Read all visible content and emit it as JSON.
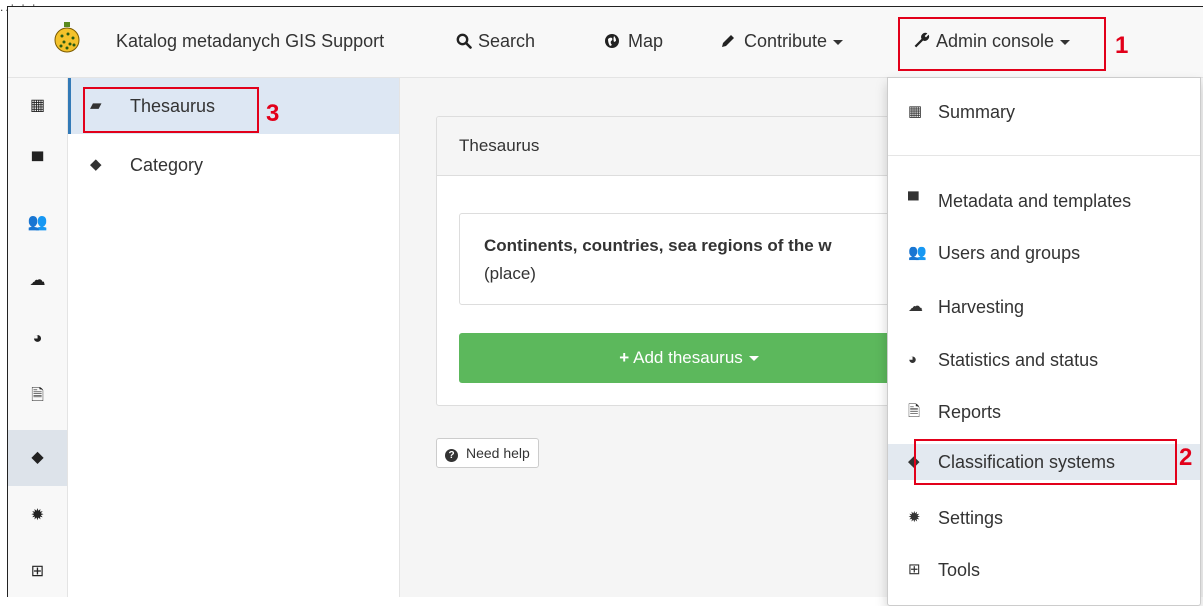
{
  "top_corner_mark": "..;.;.;",
  "navbar": {
    "brand": "Katalog metadanych GIS Support",
    "items": [
      {
        "label": "Search",
        "icon": "search-icon"
      },
      {
        "label": "Map",
        "icon": "globe-icon"
      },
      {
        "label": "Contribute",
        "icon": "pencil-icon"
      },
      {
        "label": "Admin console",
        "icon": "wrench-icon"
      }
    ]
  },
  "annotations": {
    "one": "1",
    "two": "2",
    "three": "3"
  },
  "icon_sidebar": [
    "grid-icon",
    "archive-icon",
    "users-icon",
    "cloud-download-icon",
    "dashboard-icon",
    "file-icon",
    "tags-icon",
    "gear-icon",
    "medkit-icon"
  ],
  "subsidebar": [
    {
      "label": "Thesaurus",
      "icon": "book-icon"
    },
    {
      "label": "Category",
      "icon": "tags-icon"
    }
  ],
  "main": {
    "panel_title": "Thesaurus",
    "thesaurus_title": "Continents, countries, sea regions of the w",
    "thesaurus_type": "(place)",
    "add_button": "Add thesaurus",
    "help_button": "Need help"
  },
  "dropdown": [
    {
      "label": "Summary",
      "icon": "grid-icon"
    },
    {
      "label": "Metadata and templates",
      "icon": "archive-icon"
    },
    {
      "label": "Users and groups",
      "icon": "users-icon"
    },
    {
      "label": "Harvesting",
      "icon": "cloud-download-icon"
    },
    {
      "label": "Statistics and status",
      "icon": "dashboard-icon"
    },
    {
      "label": "Reports",
      "icon": "file-icon"
    },
    {
      "label": "Classification systems",
      "icon": "tags-icon"
    },
    {
      "label": "Settings",
      "icon": "gear-icon"
    },
    {
      "label": "Tools",
      "icon": "medkit-icon"
    }
  ],
  "colors": {
    "accent": "#337ab7",
    "success": "#5cb85c",
    "annotation": "#e2001a"
  }
}
